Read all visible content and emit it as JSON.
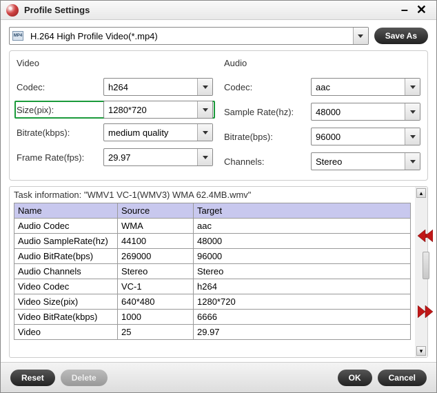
{
  "window": {
    "title": "Profile Settings"
  },
  "profile": {
    "selected": "H.264 High Profile Video(*.mp4)",
    "saveAs": "Save As"
  },
  "sections": {
    "video": "Video",
    "audio": "Audio"
  },
  "video": {
    "codec": {
      "label": "Codec:",
      "value": "h264"
    },
    "size": {
      "label": "Size(pix):",
      "value": "1280*720"
    },
    "bitrate": {
      "label": "Bitrate(kbps):",
      "value": "medium quality"
    },
    "fps": {
      "label": "Frame Rate(fps):",
      "value": "29.97"
    }
  },
  "audio": {
    "codec": {
      "label": "Codec:",
      "value": "aac"
    },
    "samplerate": {
      "label": "Sample Rate(hz):",
      "value": "48000"
    },
    "bitrate": {
      "label": "Bitrate(bps):",
      "value": "96000"
    },
    "channels": {
      "label": "Channels:",
      "value": "Stereo"
    }
  },
  "task": {
    "title": "Task information: \"WMV1 VC-1(WMV3) WMA 62.4MB.wmv\"",
    "headers": {
      "name": "Name",
      "source": "Source",
      "target": "Target"
    },
    "rows": [
      {
        "name": "Audio Codec",
        "source": "WMA",
        "target": "aac"
      },
      {
        "name": "Audio SampleRate(hz)",
        "source": "44100",
        "target": "48000"
      },
      {
        "name": "Audio BitRate(bps)",
        "source": "269000",
        "target": "96000"
      },
      {
        "name": "Audio Channels",
        "source": "Stereo",
        "target": "Stereo"
      },
      {
        "name": "Video Codec",
        "source": "VC-1",
        "target": "h264"
      },
      {
        "name": "Video Size(pix)",
        "source": "640*480",
        "target": "1280*720"
      },
      {
        "name": "Video BitRate(kbps)",
        "source": "1000",
        "target": "6666"
      },
      {
        "name": "Video",
        "source": "25",
        "target": "29.97"
      }
    ]
  },
  "buttons": {
    "reset": "Reset",
    "delete": "Delete",
    "ok": "OK",
    "cancel": "Cancel"
  }
}
